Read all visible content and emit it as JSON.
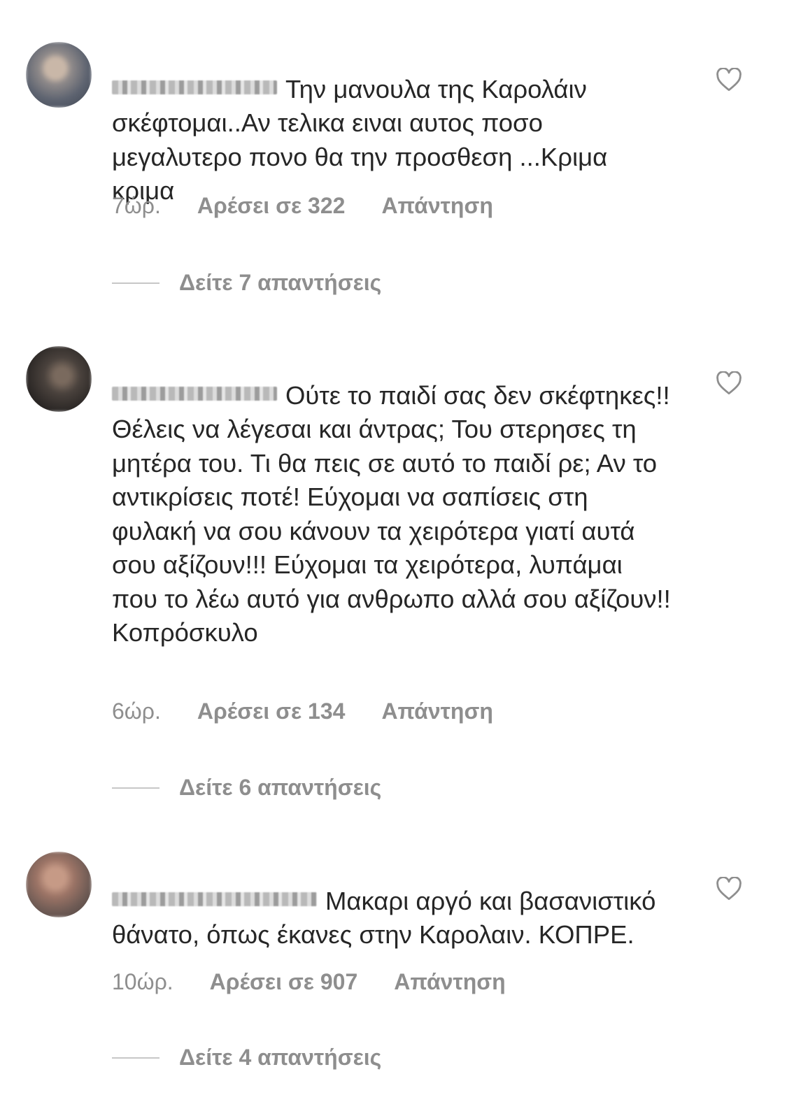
{
  "comments": [
    {
      "username": "a_lol_anthou",
      "text": "Την μανουλα της Καρολάιν σκέφτομαι..Αν τελικα ειναι αυτος ποσο μεγαλυτερο πονο θα την προσθεση ...Κριμα κριμα",
      "time": "7ώρ.",
      "likes": "Αρέσει σε 322",
      "reply": "Απάντηση",
      "view_replies": "Δείτε 7 απαντήσεις",
      "avatar_color": "#6b6f7a"
    },
    {
      "username": "nikitra_ptsl",
      "text": "Ούτε το παιδί σας δεν σκέφτηκες!! Θέλεις να λέγεσαι και άντρας; Του στερησες τη μητέρα του. Τι θα πεις σε αυτό το παιδί ρε; Αν το αντικρίσεις ποτέ! Εύχομαι να σαπίσεις στη φυλακή να σου κάνουν τα χειρότερα γιατί αυτά σου αξίζουν!!! Εύχομαι τα χειρότερα, λυπάμαι που το λέω αυτό για ανθρωπο αλλά σου αξίζουν!! Κοπρόσκυλο",
      "time": "6ώρ.",
      "likes": "Αρέσει σε 134",
      "reply": "Απάντηση",
      "view_replies": "Δείτε 6 απαντήσεις",
      "avatar_color": "#3f3a36"
    },
    {
      "username": "an_tfkl_thusta",
      "text": "Μακαρι αργό και βασανιστικό θάνατο, όπως έκανες στην Καρολαιν. ΚΟΠΡΕ.",
      "time": "10ώρ.",
      "likes": "Αρέσει σε 907",
      "reply": "Απάντηση",
      "view_replies": "Δείτε 4 απαντήσεις",
      "avatar_color": "#9a7a6c"
    }
  ]
}
